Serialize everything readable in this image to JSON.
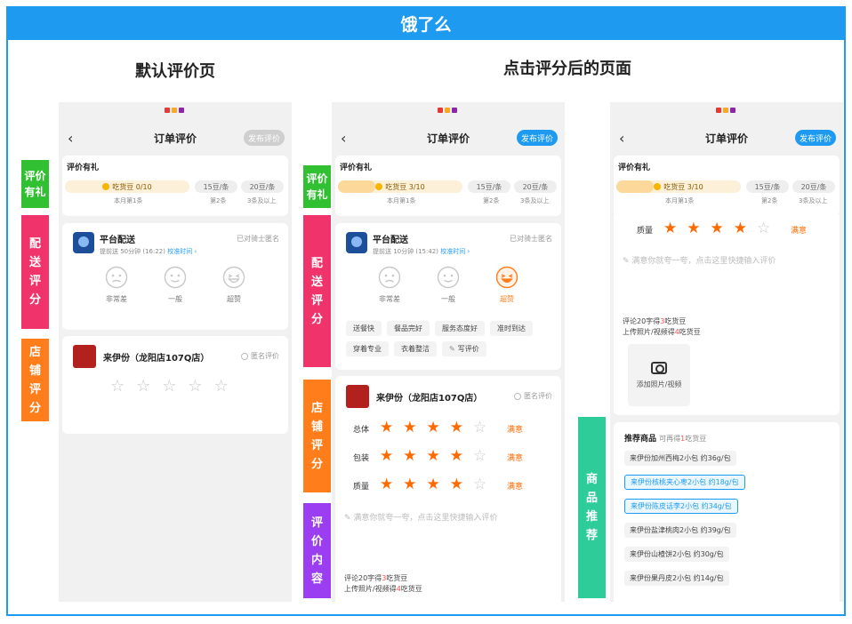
{
  "banner": {
    "title": "饿了么"
  },
  "headings": {
    "default": "默认评价页",
    "after": "点击评分后的页面"
  },
  "tags": {
    "gift": "评价有礼",
    "delivery": "配送评分",
    "shop": "店铺评分",
    "content": "评价内容",
    "recommend": "商品推荐"
  },
  "colors": {
    "brand": "#1e9bf0",
    "star": "#ff6a00",
    "tag_green": "#31c031",
    "tag_pink": "#f0336a",
    "tag_orange": "#ff7d1a",
    "tag_purple": "#9b3df0",
    "tag_teal": "#2dcc98"
  },
  "nav": {
    "back": "‹",
    "title": "订单评价",
    "publish": "发布评价"
  },
  "gift": {
    "title": "评价有礼",
    "seg2": "15豆/条",
    "seg3": "20豆/条",
    "sub1": "本月第1条",
    "sub2": "第2条",
    "sub3": "3条及以上",
    "beans_default": "吃货豆 0/10",
    "beans_after": "吃货豆 3/10",
    "progress_after": 0.3
  },
  "rider": {
    "name": "平台配送",
    "time_default": "提前送 50分钟 (16:22)",
    "time_after": "提前送 10分钟 (15:42)",
    "link": "校准时间 ›",
    "anon": "已对骑士匿名"
  },
  "faces": [
    "非常差",
    "一般",
    "超赞"
  ],
  "chips": [
    "送餐快",
    "餐品完好",
    "服务态度好",
    "准时到达",
    "穿着专业",
    "衣着整洁",
    "写评价"
  ],
  "shop": {
    "name": "来伊份（龙阳店107Q店）",
    "anon": "匿名评价"
  },
  "ratings": [
    {
      "label": "总体",
      "stars": 4,
      "value": "满意"
    },
    {
      "label": "包装",
      "stars": 4,
      "value": "满意"
    },
    {
      "label": "质量",
      "stars": 4,
      "value": "满意"
    }
  ],
  "review": {
    "hint": "满意你就夸一夸，点击这里快捷输入评价",
    "reward_line1_a": "评论20字得",
    "reward_line1_n": "3",
    "reward_line1_b": "吃货豆",
    "reward_line2_a": "上传照片/视频得",
    "reward_line2_n": "4",
    "reward_line2_b": "吃货豆",
    "upload": "添加照片/视频"
  },
  "recommend": {
    "title": "推荐商品",
    "note_a": "可再得",
    "note_n": "1",
    "note_b": "吃货豆",
    "items": [
      "来伊份加州西梅2小包 约36g/包",
      "来伊份核桃夹心枣2小包 约18g/包",
      "来伊份陈皮话李2小包 约34g/包",
      "来伊份盐津桃肉2小包 约39g/包",
      "来伊份山楂饼2小包 约30g/包",
      "来伊份果丹皮2小包 约14g/包"
    ]
  }
}
